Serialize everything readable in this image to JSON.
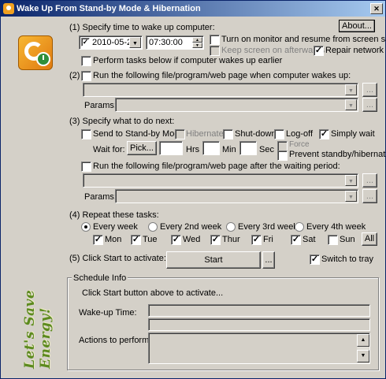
{
  "window": {
    "title": "Wake Up From Stand-by Mode & Hibernation"
  },
  "about_label": "About...",
  "slogan": "Let's Save Energy!",
  "section1": {
    "label": "(1) Specify time to wake up computer:",
    "date": "2010-05-27",
    "time": "07:30:00",
    "turn_on_monitor": "Turn on monitor and resume from screen saver",
    "keep_screen": "Keep screen on afterwards",
    "repair_network": "Repair network",
    "perform_tasks": "Perform tasks below if computer wakes up earlier"
  },
  "section2": {
    "label": "Run the following file/program/web page when computer wakes up:",
    "params_label": "Params:",
    "browse_label": "..."
  },
  "section3": {
    "label": "(3) Specify what to do next:",
    "send_standby": "Send to Stand-by Mode",
    "hibernate": "Hibernate",
    "shutdown": "Shut-down",
    "logoff": "Log-off",
    "simply_wait": "Simply wait",
    "wait_for": "Wait for:",
    "pick_label": "Pick...",
    "hrs": "Hrs",
    "min": "Min",
    "sec": "Sec",
    "force": "Force",
    "prevent": "Prevent standby/hibernat.",
    "run_after": "Run the following file/program/web page after the waiting period:",
    "params_label": "Params:",
    "browse_label": "..."
  },
  "section4": {
    "label": "(4) Repeat these tasks:",
    "repeat": [
      "Every week",
      "Every 2nd week",
      "Every 3rd week",
      "Every 4th week"
    ],
    "days": [
      "Mon",
      "Tue",
      "Wed",
      "Thur",
      "Fri",
      "Sat",
      "Sun"
    ],
    "all_label": "All"
  },
  "section5": {
    "label": "(5) Click Start to activate:",
    "start_label": "Start",
    "more_label": "...",
    "switch_tray": "Switch to tray"
  },
  "schedule": {
    "title": "Schedule Info",
    "status": "Click Start button above to activate...",
    "wakeup_label": "Wake-up Time:",
    "actions_label": "Actions to perform:"
  }
}
